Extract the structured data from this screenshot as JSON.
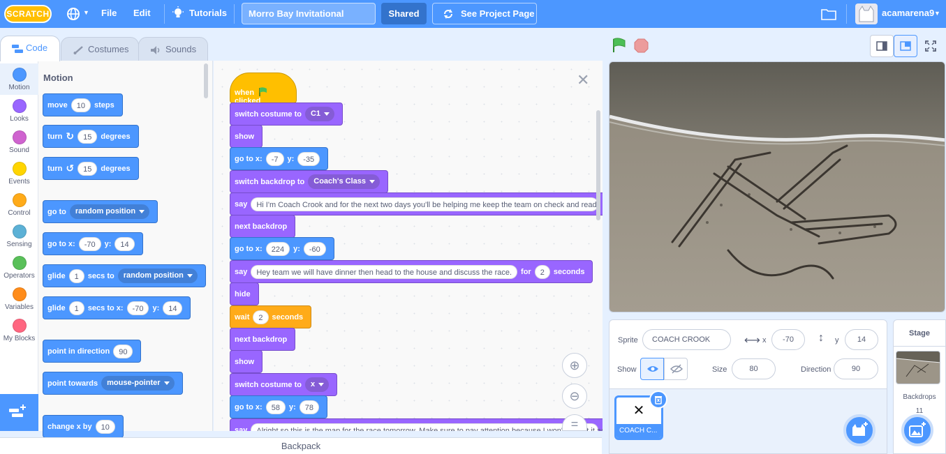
{
  "menu": {
    "logo": "SCRATCH",
    "file": "File",
    "edit": "Edit",
    "tutorials": "Tutorials",
    "project_title": "Morro Bay Invitational",
    "shared": "Shared",
    "see_project_page": "See Project Page",
    "username": "acamarena9"
  },
  "tabs": {
    "code": "Code",
    "costumes": "Costumes",
    "sounds": "Sounds"
  },
  "categories": [
    {
      "label": "Motion",
      "color": "#4c97ff"
    },
    {
      "label": "Looks",
      "color": "#9966ff"
    },
    {
      "label": "Sound",
      "color": "#cf63cf"
    },
    {
      "label": "Events",
      "color": "#ffd500"
    },
    {
      "label": "Control",
      "color": "#ffab19"
    },
    {
      "label": "Sensing",
      "color": "#5cb1d6"
    },
    {
      "label": "Operators",
      "color": "#59c059"
    },
    {
      "label": "Variables",
      "color": "#ff8c1a"
    },
    {
      "label": "My Blocks",
      "color": "#ff6680"
    }
  ],
  "palette": {
    "title": "Motion",
    "move": {
      "a": "move",
      "v": "10",
      "b": "steps"
    },
    "turn_cw": {
      "a": "turn",
      "v": "15",
      "b": "degrees"
    },
    "turn_ccw": {
      "a": "turn",
      "v": "15",
      "b": "degrees"
    },
    "goto_random": {
      "a": "go to",
      "d": "random position"
    },
    "goto_xy": {
      "a": "go to x:",
      "x": "-70",
      "b": "y:",
      "y": "14"
    },
    "glide_random": {
      "a": "glide",
      "v": "1",
      "b": "secs to",
      "d": "random position"
    },
    "glide_xy": {
      "a": "glide",
      "v": "1",
      "b": "secs to x:",
      "x": "-70",
      "c": "y:",
      "y": "14"
    },
    "point_dir": {
      "a": "point in direction",
      "v": "90"
    },
    "point_towards": {
      "a": "point towards",
      "d": "mouse-pointer"
    },
    "change_x": {
      "a": "change x by",
      "v": "10"
    }
  },
  "script": {
    "hat": {
      "a": "when",
      "b": "clicked"
    },
    "s1": {
      "a": "switch costume to",
      "d": "C1"
    },
    "s2": {
      "a": "show"
    },
    "s3": {
      "a": "go to x:",
      "x": "-7",
      "b": "y:",
      "y": "-35"
    },
    "s4": {
      "a": "switch backdrop to",
      "d": "Coach's Class"
    },
    "s5": {
      "a": "say",
      "v": "Hi I'm Coach Crook and for the next two days you'll be helping me keep the team on check and ready"
    },
    "s6": {
      "a": "next backdrop"
    },
    "s7": {
      "a": "go to x:",
      "x": "224",
      "b": "y:",
      "y": "-60"
    },
    "s8": {
      "a": "say",
      "v": "Hey team we will have dinner then head to the house and discuss the race.",
      "b": "for",
      "n": "2",
      "c": "seconds"
    },
    "s9": {
      "a": "hide"
    },
    "s10": {
      "a": "wait",
      "v": "2",
      "b": "seconds"
    },
    "s11": {
      "a": "next backdrop"
    },
    "s12": {
      "a": "show"
    },
    "s13": {
      "a": "switch costume to",
      "d": "x"
    },
    "s14": {
      "a": "go to x:",
      "x": "58",
      "b": "y:",
      "y": "78"
    },
    "s15": {
      "a": "say",
      "v": "Alright so this is the map for the race tomorrow. Make sure to pay attention because I won't repeat it ag"
    }
  },
  "backpack": "Backpack",
  "sprite_info": {
    "sprite_label": "Sprite",
    "sprite_name": "COACH CROOK",
    "x_label": "x",
    "x": "-70",
    "y_label": "y",
    "y": "14",
    "show_label": "Show",
    "size_label": "Size",
    "size": "80",
    "direction_label": "Direction",
    "direction": "90"
  },
  "sprite_tile": {
    "glyph": "✕",
    "name": "COACH C..."
  },
  "stage_panel": {
    "title": "Stage",
    "backdrops_label": "Backdrops",
    "backdrops_count": "11"
  }
}
